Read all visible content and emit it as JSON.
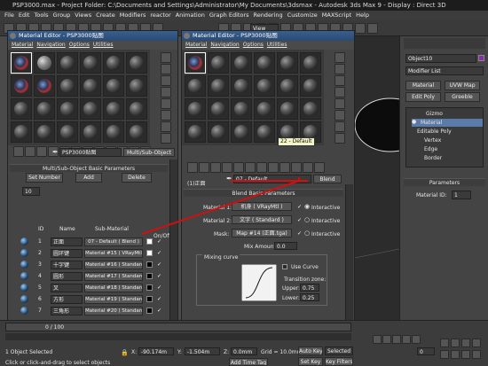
{
  "app": {
    "title": "PSP3000.max - Project Folder: C:\\Documents and Settings\\Administrator\\My Documents\\3dsmax - Autodesk 3ds Max 9 - Display : Direct 3D"
  },
  "menubar": [
    "File",
    "Edit",
    "Tools",
    "Group",
    "Views",
    "Create",
    "Modifiers",
    "reactor",
    "Animation",
    "Graph Editors",
    "Rendering",
    "Customize",
    "MAXScript",
    "Help"
  ],
  "toolbar": {
    "view_dropdown": "View"
  },
  "mat_editor_left": {
    "title": "Material Editor - PSP3000贴图",
    "menu": [
      "Material",
      "Navigation",
      "Options",
      "Utilities"
    ],
    "material_name": "PSP3000贴图",
    "material_type": "Multi/Sub-Object",
    "rollout_title": "Multi/Sub-Object Basic Parameters",
    "set_number_label": "Set Number",
    "set_number_value": "10",
    "add_label": "Add",
    "delete_label": "Delete",
    "col_id": "ID",
    "col_name": "Name",
    "col_sub": "Sub-Material",
    "col_onoff": "On/Off",
    "rows": [
      {
        "id": "1",
        "name": "正面",
        "sub": "07 - Default ( Blend )"
      },
      {
        "id": "2",
        "name": "圆环键",
        "sub": "Material #15  ( VRayMtl )"
      },
      {
        "id": "3",
        "name": "十字键",
        "sub": "Material #16  ( Standard )"
      },
      {
        "id": "4",
        "name": "圆形",
        "sub": "Material #17  ( Standard )"
      },
      {
        "id": "5",
        "name": "叉",
        "sub": "Material #18  ( Standard )"
      },
      {
        "id": "6",
        "name": "方形",
        "sub": "Material #19  ( Standard )"
      },
      {
        "id": "7",
        "name": "三角形",
        "sub": "Material #20  ( Standard )"
      }
    ]
  },
  "mat_editor_right": {
    "title": "Material Editor - PSP3000贴图",
    "menu": [
      "Material",
      "Navigation",
      "Options",
      "Utilities"
    ],
    "material_name": "PSP3000贴图",
    "material_name_2": "07 - Default",
    "level_label": "(1)正面",
    "material_type": "Blend",
    "tooltip": "22 - Default",
    "rollout_title": "Blend Basic Parameters",
    "mat1_label": "Material 1:",
    "mat1_value": "机身 ( VRayMtl )",
    "mat2_label": "Material 2:",
    "mat2_value": "文字 ( Standard )",
    "mask_label": "Mask:",
    "mask_value": "Map #14 (正面.tga)",
    "interactive_label": "Interactive",
    "mix_amount_label": "Mix Amount:",
    "mix_amount_value": "0.0",
    "mixing_curve_label": "Mixing curve",
    "use_curve_label": "Use Curve",
    "transition_zone_label": "Transition zone:",
    "upper_label": "Upper:",
    "upper_value": "0.75",
    "lower_label": "Lower:",
    "lower_value": "0.25"
  },
  "cmd_panel": {
    "object_name": "Object10",
    "modifier_list": "Modifier List",
    "buttons": [
      "Material",
      "UVW Map",
      "Edit Poly",
      "Greeble"
    ],
    "stack": [
      "Gizmo",
      "Material",
      "Editable Poly",
      "Vertex",
      "Edge",
      "Border"
    ],
    "parameters_label": "Parameters",
    "material_id_label": "Material ID:",
    "material_id_value": "1"
  },
  "status": {
    "frame": "0 / 100",
    "selected": "1 Object Selected",
    "hint": "Click or click-and-drag to select objects",
    "x_label": "X:",
    "x_value": "-90.174m",
    "y_label": "Y:",
    "y_value": "-1.504m",
    "z_label": "Z:",
    "z_value": "0.0mm",
    "grid": "Grid = 10.0mm",
    "auto_key": "Auto Key",
    "selected_dd": "Selected",
    "set_key": "Set Key",
    "key_filters": "Key Filters...",
    "add_time_tag": "Add Time Tag",
    "frame_counter": "0"
  },
  "colors": {
    "accent_title": "#2a4a72",
    "red_arrow": "#d01010"
  }
}
